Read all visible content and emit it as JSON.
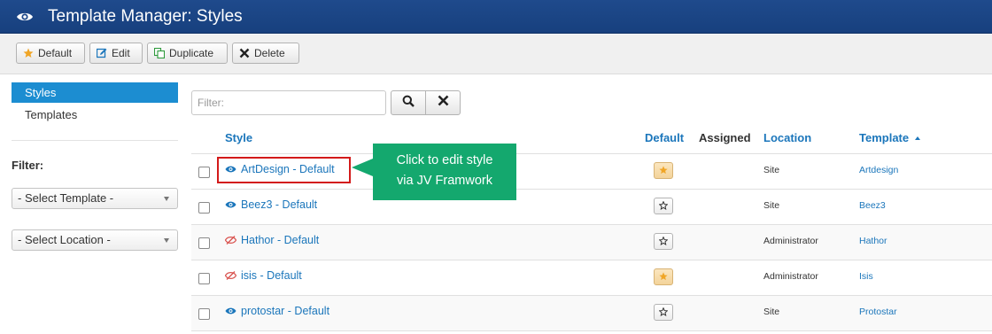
{
  "header": {
    "title": "Template Manager: Styles",
    "icon": "eye-icon"
  },
  "toolbar": {
    "default_label": "Default",
    "edit_label": "Edit",
    "duplicate_label": "Duplicate",
    "delete_label": "Delete"
  },
  "sidebar": {
    "items": [
      {
        "label": "Styles",
        "active": true
      },
      {
        "label": "Templates",
        "active": false
      }
    ],
    "filter_label": "Filter:",
    "select_template": "- Select Template -",
    "select_location": "- Select Location -"
  },
  "search": {
    "placeholder": "Filter:"
  },
  "table": {
    "headers": {
      "style": "Style",
      "default": "Default",
      "assigned": "Assigned",
      "location": "Location",
      "template": "Template"
    },
    "rows": [
      {
        "style": "ArtDesign - Default",
        "location": "Site",
        "template": "Artdesign",
        "is_default": true,
        "icon": "eye-icon"
      },
      {
        "style": "Beez3 - Default",
        "location": "Site",
        "template": "Beez3",
        "is_default": false,
        "icon": "eye-icon"
      },
      {
        "style": "Hathor - Default",
        "location": "Administrator",
        "template": "Hathor",
        "is_default": false,
        "icon": "eye-slash-icon"
      },
      {
        "style": "isis - Default",
        "location": "Administrator",
        "template": "Isis",
        "is_default": true,
        "icon": "eye-slash-icon"
      },
      {
        "style": "protostar - Default",
        "location": "Site",
        "template": "Protostar",
        "is_default": false,
        "icon": "eye-icon"
      }
    ]
  },
  "callout": {
    "line1": "Click to edit style",
    "line2": "via JV Framwork"
  },
  "colors": {
    "header": "#1f4a8c",
    "accent": "#1c8dd1",
    "link": "#1b76bb",
    "callout": "#14a86e",
    "highlight": "#d31a1a",
    "star_default": "#f0a526"
  }
}
